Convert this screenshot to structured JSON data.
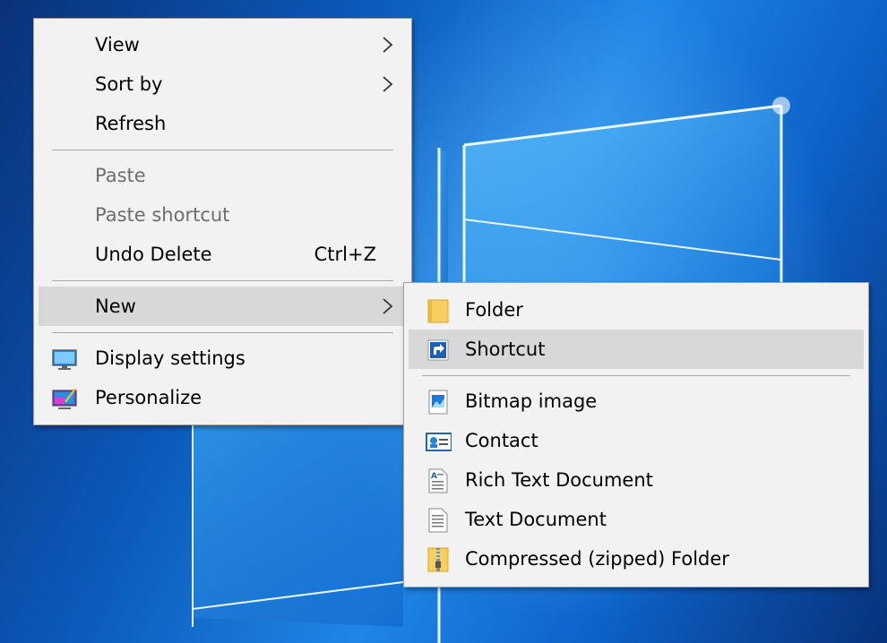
{
  "context_menu": {
    "items": [
      {
        "label": "View"
      },
      {
        "label": "Sort by"
      },
      {
        "label": "Refresh"
      },
      {
        "label": "Paste"
      },
      {
        "label": "Paste shortcut"
      },
      {
        "label": "Undo Delete",
        "shortcut": "Ctrl+Z"
      },
      {
        "label": "New"
      },
      {
        "label": "Display settings",
        "icon": "display-settings-icon"
      },
      {
        "label": "Personalize",
        "icon": "personalize-icon"
      }
    ]
  },
  "new_submenu": {
    "items": [
      {
        "label": "Folder",
        "icon": "folder-icon"
      },
      {
        "label": "Shortcut",
        "icon": "shortcut-icon"
      },
      {
        "label": "Bitmap image",
        "icon": "bitmap-image-icon"
      },
      {
        "label": "Contact",
        "icon": "contact-icon"
      },
      {
        "label": "Rich Text Document",
        "icon": "rich-text-document-icon"
      },
      {
        "label": "Text Document",
        "icon": "text-document-icon"
      },
      {
        "label": "Compressed (zipped) Folder",
        "icon": "zip-folder-icon"
      }
    ]
  },
  "colors": {
    "menu_background": "#f2f2f2",
    "highlight": "#d8d8d8",
    "disabled_text": "#6d6d6d",
    "desktop_blue": "#0b58b8"
  }
}
